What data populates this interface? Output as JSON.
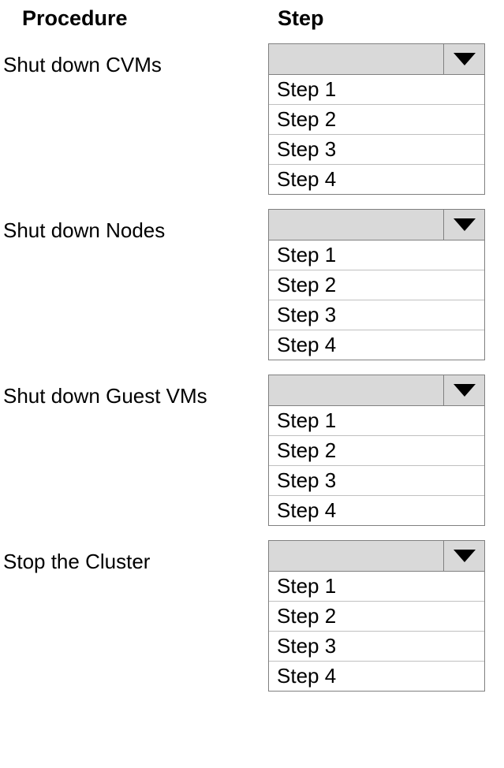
{
  "headers": {
    "procedure": "Procedure",
    "step": "Step"
  },
  "rows": [
    {
      "label": "Shut  down CVMs",
      "selected": "",
      "options": [
        "Step 1",
        "Step 2",
        "Step 3",
        "Step 4"
      ]
    },
    {
      "label": "Shut down Nodes",
      "selected": "",
      "options": [
        "Step 1",
        "Step 2",
        "Step 3",
        "Step 4"
      ]
    },
    {
      "label": "Shut down Guest VMs",
      "selected": "",
      "options": [
        "Step 1",
        "Step 2",
        "Step 3",
        "Step 4"
      ]
    },
    {
      "label": "Stop the Cluster",
      "selected": "",
      "options": [
        "Step 1",
        "Step 2",
        "Step 3",
        "Step 4"
      ]
    }
  ]
}
